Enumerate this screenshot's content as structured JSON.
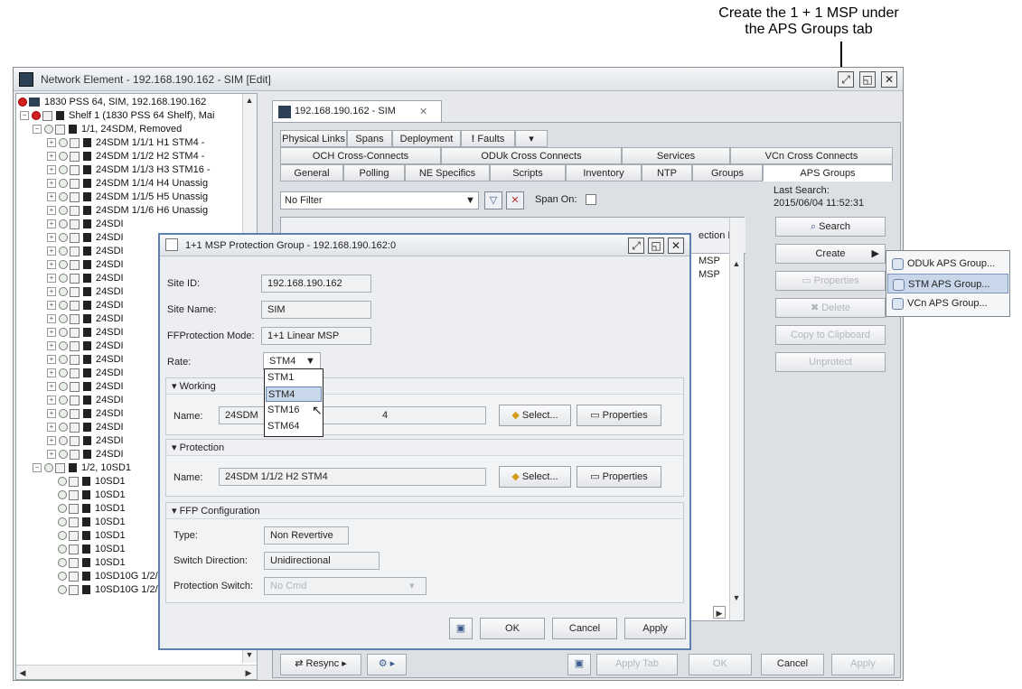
{
  "callout": {
    "line1": "Create the 1 + 1 MSP under",
    "line2": "the APS Groups tab"
  },
  "window": {
    "title": "Network Element - 192.168.190.162 - SIM [Edit]"
  },
  "tree": {
    "nodes": [
      {
        "text": "1830 PSS 64, SIM, 192.168.190.162"
      },
      {
        "text": "Shelf 1 (1830 PSS 64 Shelf), Mai"
      },
      {
        "text": "1/1, 24SDM, Removed"
      },
      {
        "text": "24SDM 1/1/1 H1 STM4 -"
      },
      {
        "text": "24SDM 1/1/2 H2 STM4 -"
      },
      {
        "text": "24SDM 1/1/3 H3 STM16 -"
      },
      {
        "text": "24SDM 1/1/4 H4 Unassig"
      },
      {
        "text": "24SDM 1/1/5 H5 Unassig"
      },
      {
        "text": "24SDM 1/1/6 H6 Unassig"
      },
      {
        "text": "24SDI"
      },
      {
        "text": "24SDI"
      },
      {
        "text": "24SDI"
      },
      {
        "text": "24SDI"
      },
      {
        "text": "24SDI"
      },
      {
        "text": "24SDI"
      },
      {
        "text": "24SDI"
      },
      {
        "text": "24SDI"
      },
      {
        "text": "24SDI"
      },
      {
        "text": "24SDI"
      },
      {
        "text": "24SDI"
      },
      {
        "text": "24SDI"
      },
      {
        "text": "24SDI"
      },
      {
        "text": "24SDI"
      },
      {
        "text": "24SDI"
      },
      {
        "text": "24SDI"
      },
      {
        "text": "24SDI"
      },
      {
        "text": "24SDI"
      },
      {
        "text": "1/2, 10SD1"
      },
      {
        "text": "10SD1"
      },
      {
        "text": "10SD1"
      },
      {
        "text": "10SD1"
      },
      {
        "text": "10SD1"
      },
      {
        "text": "10SD1"
      },
      {
        "text": "10SD1"
      },
      {
        "text": "10SD1"
      },
      {
        "text": "10SD10G 1/2/8 H8 Unas"
      },
      {
        "text": "10SD10G 1/2/9 H9 Unas"
      }
    ]
  },
  "right": {
    "tab_title": "192.168.190.162 - SIM",
    "tabs_row1": [
      "Physical Links",
      "Spans",
      "Deployment",
      "Faults"
    ],
    "tabs_row2": [
      "OCH Cross-Connects",
      "ODUk Cross Connects",
      "Services",
      "VCn Cross Connects"
    ],
    "tabs_row3": [
      "General",
      "Polling",
      "NE Specifics",
      "Scripts",
      "Inventory",
      "NTP",
      "Groups",
      "APS Groups"
    ],
    "filter": "No Filter",
    "span_on": "Span On:",
    "last_search_label": "Last Search:",
    "last_search_value": "2015/06/04 11:52:31",
    "column_header": "ection M",
    "rows": [
      "MSP",
      "MSP"
    ],
    "buttons": {
      "search": "Search",
      "create": "Create",
      "properties": "Properties",
      "delete": "Delete",
      "copy": "Copy to Clipboard",
      "unprotect": "Unprotect"
    },
    "bottom": {
      "resync": "Resync",
      "apply_tab": "Apply Tab",
      "ok": "OK",
      "cancel": "Cancel",
      "apply": "Apply"
    }
  },
  "create_menu": {
    "items": [
      "ODUk APS Group...",
      "STM APS Group...",
      "VCn APS Group..."
    ]
  },
  "dialog": {
    "title": "1+1 MSP Protection Group - 192.168.190.162:0",
    "site_id_label": "Site ID:",
    "site_id": "192.168.190.162",
    "site_name_label": "Site Name:",
    "site_name": "SIM",
    "ffp_mode_label": "FFProtection Mode:",
    "ffp_mode": "1+1 Linear MSP",
    "rate_label": "Rate:",
    "rate": "STM4",
    "rate_options": [
      "STM1",
      "STM4",
      "STM16",
      "STM64"
    ],
    "working": {
      "header": "Working",
      "name_label": "Name:",
      "name_prefix": "24SDM",
      "name_suffix": "4"
    },
    "protection": {
      "header": "Protection",
      "name_label": "Name:",
      "name": "24SDM 1/1/2 H2 STM4"
    },
    "ffp": {
      "header": "FFP Configuration",
      "type_label": "Type:",
      "type": "Non Revertive",
      "switch_dir_label": "Switch Direction:",
      "switch_dir": "Unidirectional",
      "prot_switch_label": "Protection Switch:",
      "prot_switch": "No Cmd"
    },
    "select_label": "Select...",
    "properties_label": "Properties",
    "ok": "OK",
    "cancel": "Cancel",
    "apply": "Apply"
  }
}
